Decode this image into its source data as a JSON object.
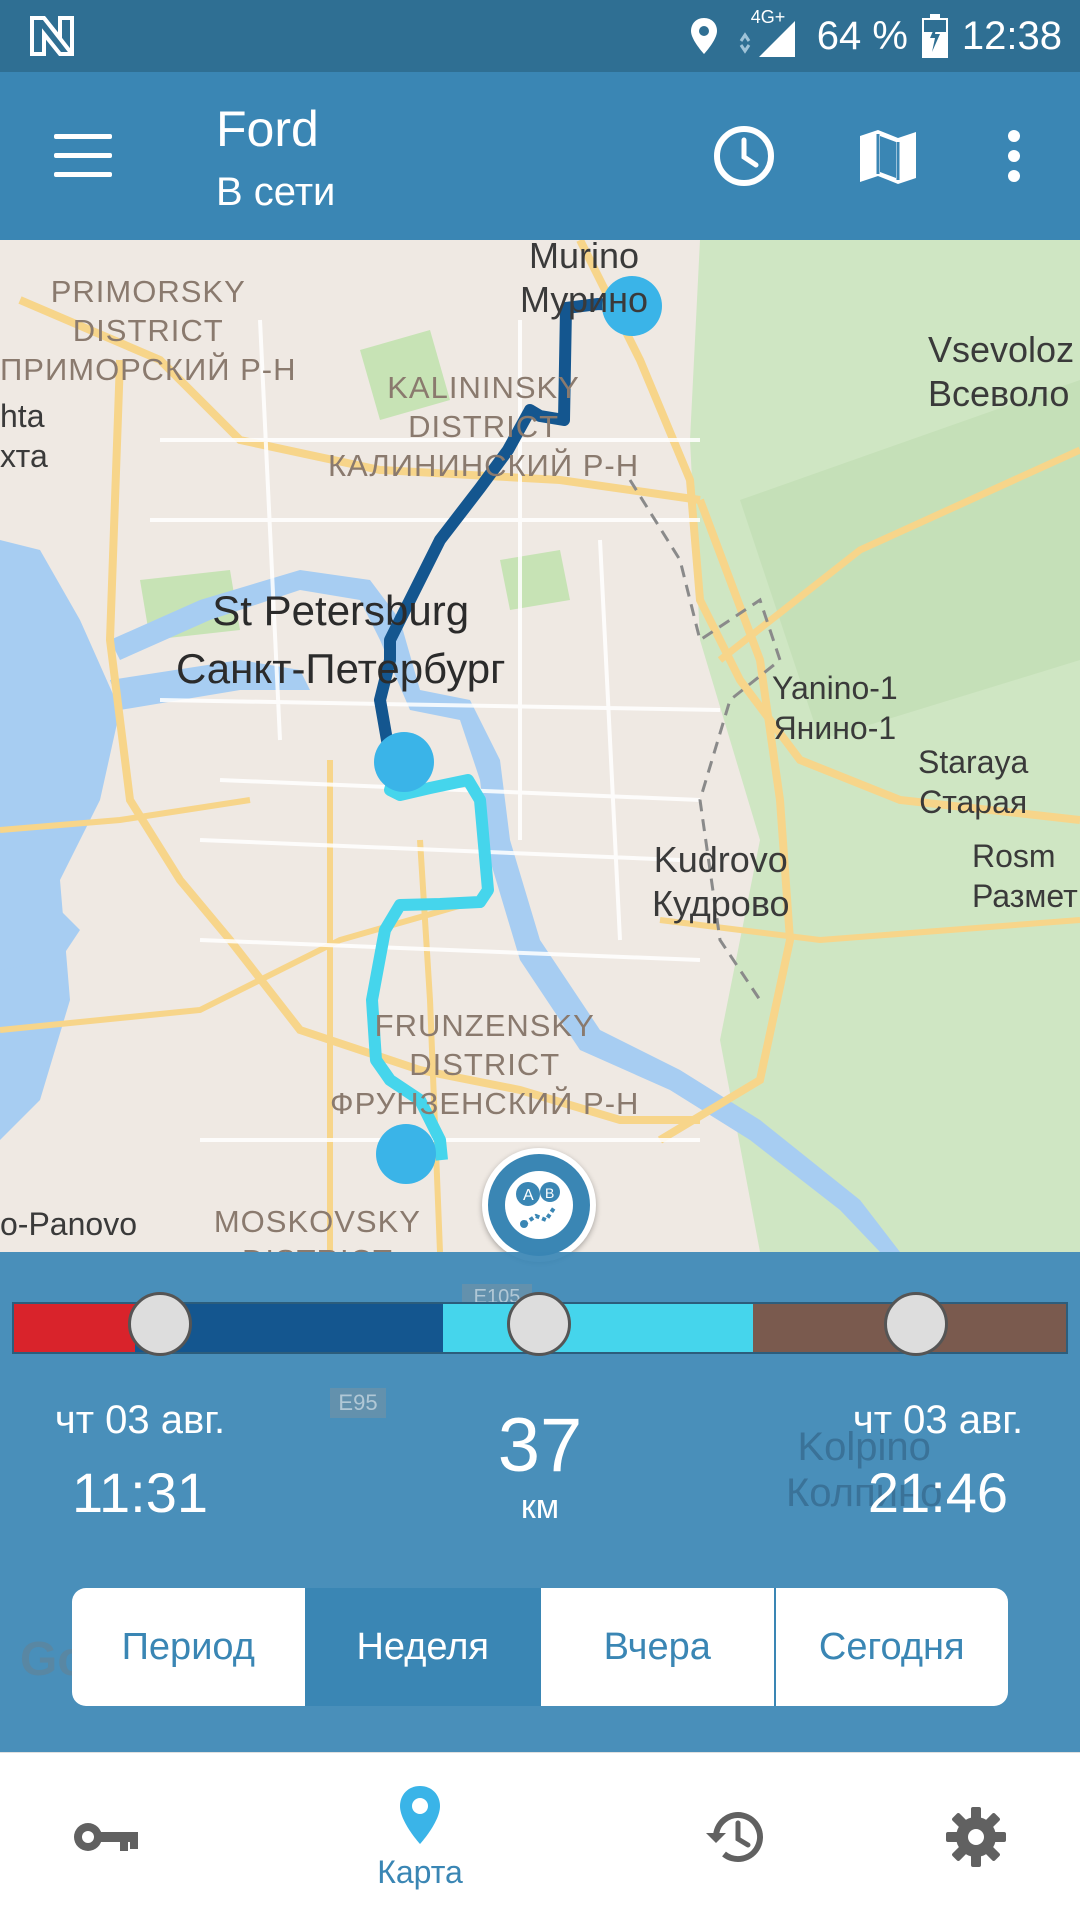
{
  "status_bar": {
    "network": "4G+",
    "battery": "64 %",
    "time": "12:38"
  },
  "app_bar": {
    "title": "Ford",
    "subtitle": "В сети"
  },
  "map": {
    "labels": {
      "murino": "Murino\nМурино",
      "primorsky": "PRIMORSKY\nDISTRICT\nПРИМОРСКИЙ Р-Н",
      "vsevoloz": "Vsevoloz\nВсеволо",
      "kalininsky": "KALININSKY\nDISTRICT\nКАЛИНИНСКИЙ Р-Н",
      "lakhta": "hta\nхта",
      "spb": "St Petersburg\nСанкт-Петербург",
      "yanino": "Yanino-1\nЯнино-1",
      "staraya": "Staraya\nСтарая",
      "kudrovo": "Kudrovo\nКудрово",
      "rosm": "Rosm\nРазмет",
      "frunzensky": "FRUNZENSKY\nDISTRICT\nФРУНЗЕНСКИЙ Р-Н",
      "panovo": "o-Panovo\no-Паново",
      "moskovsky": "MOSKOVSKY\nDISTRICT\nМОСКОВСКИЙ Р-Н",
      "kolpino": "Kolpino\nКолпино",
      "e95": "E95",
      "e105": "E105",
      "google": "Google"
    }
  },
  "route_panel": {
    "start_date": "чт 03 авг.",
    "start_time": "11:31",
    "distance_value": "37",
    "distance_unit": "км",
    "end_date": "чт 03 авг.",
    "end_time": "21:46",
    "timeline_colors": [
      "#d9232b",
      "#14568f",
      "#45d5ec",
      "#7a5a4e"
    ]
  },
  "period_selector": {
    "options": [
      "Период",
      "Неделя",
      "Вчера",
      "Сегодня"
    ],
    "active": "Неделя"
  },
  "bottom_nav": {
    "map_label": "Карта"
  },
  "colors": {
    "primary": "#3a86b4",
    "status_bar": "#2f6f93",
    "route_dark": "#14568f",
    "route_light": "#45d5ec",
    "marker": "#3ab4e8"
  }
}
